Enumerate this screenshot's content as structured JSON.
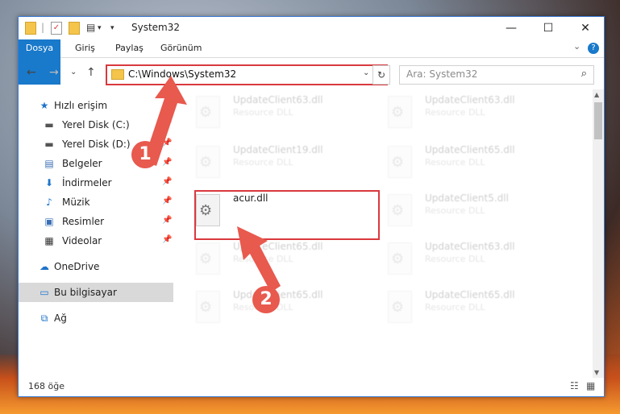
{
  "window": {
    "title": "System32",
    "quick_access_separator": "|",
    "dropdown_glyph": "▾",
    "buttons": {
      "minimize": "—",
      "maximize": "☐",
      "close": "✕"
    }
  },
  "ribbon": {
    "tabs": [
      "Dosya",
      "Giriş",
      "Paylaş",
      "Görünüm"
    ],
    "expand_glyph": "⌄",
    "help_glyph": "?"
  },
  "nav": {
    "back_glyph": "←",
    "forward_glyph": "→",
    "recent_glyph": "⌄",
    "up_glyph": "↑",
    "address": "C:\\Windows\\System32",
    "address_chevron": "⌄",
    "refresh_glyph": "↻",
    "search_placeholder": "Ara: System32",
    "search_glyph": "⌕"
  },
  "sidebar": {
    "items": [
      {
        "label": "Hızlı erişim",
        "icon": "star-icon",
        "glyph": "★",
        "color": "#1e73c9",
        "pinned": false
      },
      {
        "label": "Yerel Disk (C:)",
        "icon": "drive-icon",
        "glyph": "▬",
        "color": "#555555",
        "pinned": true
      },
      {
        "label": "Yerel Disk (D:)",
        "icon": "drive-icon",
        "glyph": "▬",
        "color": "#555555",
        "pinned": true
      },
      {
        "label": "Belgeler",
        "icon": "documents-icon",
        "glyph": "▤",
        "color": "#3a6fb5",
        "pinned": true
      },
      {
        "label": "İndirmeler",
        "icon": "download-icon",
        "glyph": "⬇",
        "color": "#1e73c9",
        "pinned": true
      },
      {
        "label": "Müzik",
        "icon": "music-icon",
        "glyph": "♪",
        "color": "#1e73c9",
        "pinned": true
      },
      {
        "label": "Resimler",
        "icon": "pictures-icon",
        "glyph": "▣",
        "color": "#3a6fb5",
        "pinned": true
      },
      {
        "label": "Videolar",
        "icon": "video-icon",
        "glyph": "▦",
        "color": "#333333",
        "pinned": true
      },
      {
        "label": "OneDrive",
        "icon": "cloud-icon",
        "glyph": "☁",
        "color": "#1e73c9",
        "pinned": false
      },
      {
        "label": "Bu bilgisayar",
        "icon": "computer-icon",
        "glyph": "▭",
        "color": "#1e73c9",
        "pinned": false
      },
      {
        "label": "Ağ",
        "icon": "network-icon",
        "glyph": "⧉",
        "color": "#1e73c9",
        "pinned": false
      }
    ],
    "pin_glyph": "📌"
  },
  "files": [
    {
      "name": "UpdateClient63.dll",
      "type": "Resource DLL"
    },
    {
      "name": "UpdateClient63.dll",
      "type": "Resource DLL"
    },
    {
      "name": "UpdateClient19.dll",
      "type": "Resource DLL"
    },
    {
      "name": "UpdateClient65.dll",
      "type": "Resource DLL"
    },
    {
      "name": "acur.dll",
      "type": ""
    },
    {
      "name": "UpdateClient5.dll",
      "type": "Resource DLL"
    },
    {
      "name": "UpdateClient65.dll",
      "type": "Resource DLL"
    },
    {
      "name": "UpdateClient63.dll",
      "type": "Resource DLL"
    },
    {
      "name": "UpdateClient65.dll",
      "type": "Resource DLL"
    },
    {
      "name": "UpdateClient65.dll",
      "type": "Resource DLL"
    }
  ],
  "status": {
    "count": "168 öğe"
  },
  "annotations": {
    "step1": "1",
    "step2": "2"
  },
  "colors": {
    "accent": "#1979ca",
    "highlight": "#d9393e",
    "annotation": "#e8594e"
  }
}
